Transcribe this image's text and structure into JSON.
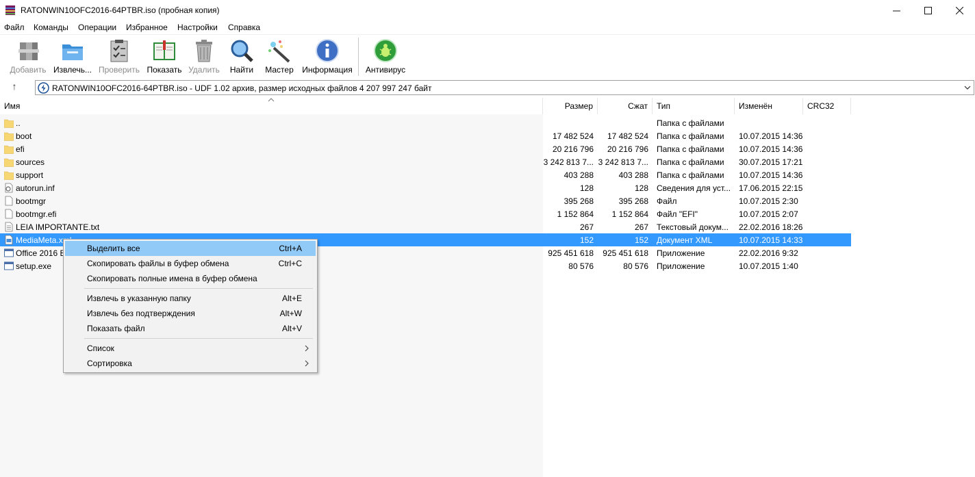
{
  "window": {
    "title": "RATONWIN10OFC2016-64PTBR.iso (пробная копия)",
    "minimize_glyph": "—",
    "maximize_glyph": "☐",
    "close_glyph": "✕"
  },
  "menu": {
    "items": [
      "Файл",
      "Команды",
      "Операции",
      "Избранное",
      "Настройки",
      "Справка"
    ]
  },
  "toolbar": {
    "buttons": [
      {
        "label": "Добавить",
        "icon": "archive-add-icon",
        "disabled": true
      },
      {
        "label": "Извлечь...",
        "icon": "extract-folder-icon",
        "disabled": false
      },
      {
        "label": "Проверить",
        "icon": "test-clipboard-icon",
        "disabled": true
      },
      {
        "label": "Показать",
        "icon": "view-book-icon",
        "disabled": false
      },
      {
        "label": "Удалить",
        "icon": "trash-icon",
        "disabled": true
      },
      {
        "label": "Найти",
        "icon": "magnifier-icon",
        "disabled": false
      },
      {
        "label": "Мастер",
        "icon": "wizard-wand-icon",
        "disabled": false
      },
      {
        "label": "Информация",
        "icon": "info-icon",
        "disabled": false
      },
      {
        "label": "Антивирус",
        "icon": "antivirus-bug-icon",
        "disabled": false
      }
    ]
  },
  "address": {
    "up_glyph": "↑",
    "text": "RATONWIN10OFC2016-64PTBR.iso - UDF 1.02 архив, размер исходных файлов 4 207 997 247 байт"
  },
  "columns": {
    "name": "Имя",
    "size": "Размер",
    "packed": "Сжат",
    "type": "Тип",
    "modified": "Изменён",
    "crc": "CRC32"
  },
  "files": [
    {
      "name": "..",
      "size": "",
      "packed": "",
      "type": "Папка с файлами",
      "modified": "",
      "icon": "folder-icon",
      "selected": false
    },
    {
      "name": "boot",
      "size": "17 482 524",
      "packed": "17 482 524",
      "type": "Папка с файлами",
      "modified": "10.07.2015 14:36",
      "icon": "folder-icon",
      "selected": false
    },
    {
      "name": "efi",
      "size": "20 216 796",
      "packed": "20 216 796",
      "type": "Папка с файлами",
      "modified": "10.07.2015 14:36",
      "icon": "folder-icon",
      "selected": false
    },
    {
      "name": "sources",
      "size": "3 242 813 7...",
      "packed": "3 242 813 7...",
      "type": "Папка с файлами",
      "modified": "30.07.2015 17:21",
      "icon": "folder-icon",
      "selected": false
    },
    {
      "name": "support",
      "size": "403 288",
      "packed": "403 288",
      "type": "Папка с файлами",
      "modified": "10.07.2015 14:36",
      "icon": "folder-icon",
      "selected": false
    },
    {
      "name": "autorun.inf",
      "size": "128",
      "packed": "128",
      "type": "Сведения для уст...",
      "modified": "17.06.2015 22:15",
      "icon": "settings-file-icon",
      "selected": false
    },
    {
      "name": "bootmgr",
      "size": "395 268",
      "packed": "395 268",
      "type": "Файл",
      "modified": "10.07.2015 2:30",
      "icon": "file-icon",
      "selected": false
    },
    {
      "name": "bootmgr.efi",
      "size": "1 152 864",
      "packed": "1 152 864",
      "type": "Файл \"EFI\"",
      "modified": "10.07.2015 2:07",
      "icon": "file-icon",
      "selected": false
    },
    {
      "name": "LEIA IMPORTANTE.txt",
      "size": "267",
      "packed": "267",
      "type": "Текстовый докум...",
      "modified": "22.02.2016 18:26",
      "icon": "text-file-icon",
      "selected": false
    },
    {
      "name": "MediaMeta.xml",
      "size": "152",
      "packed": "152",
      "type": "Документ XML",
      "modified": "10.07.2015 14:33",
      "icon": "xml-file-icon",
      "selected": true
    },
    {
      "name": "Office 2016 B",
      "size": "925 451 618",
      "packed": "925 451 618",
      "type": "Приложение",
      "modified": "22.02.2016 9:32",
      "icon": "app-window-icon",
      "selected": false
    },
    {
      "name": "setup.exe",
      "size": "80 576",
      "packed": "80 576",
      "type": "Приложение",
      "modified": "10.07.2015 1:40",
      "icon": "app-window-icon",
      "selected": false
    }
  ],
  "context_menu": {
    "groups": [
      [
        {
          "label": "Выделить все",
          "shortcut": "Ctrl+A",
          "highlighted": true
        },
        {
          "label": "Скопировать файлы в буфер обмена",
          "shortcut": "Ctrl+C"
        },
        {
          "label": "Скопировать полные имена в буфер обмена",
          "shortcut": ""
        }
      ],
      [
        {
          "label": "Извлечь в указанную папку",
          "shortcut": "Alt+E"
        },
        {
          "label": "Извлечь без подтверждения",
          "shortcut": "Alt+W"
        },
        {
          "label": "Показать файл",
          "shortcut": "Alt+V"
        }
      ],
      [
        {
          "label": "Список",
          "shortcut": "",
          "submenu": true
        },
        {
          "label": "Сортировка",
          "shortcut": "",
          "submenu": true
        }
      ]
    ]
  },
  "colors": {
    "selection": "#3399ff",
    "menu_highlight": "#91c9f7",
    "folder": "#f7d774"
  }
}
